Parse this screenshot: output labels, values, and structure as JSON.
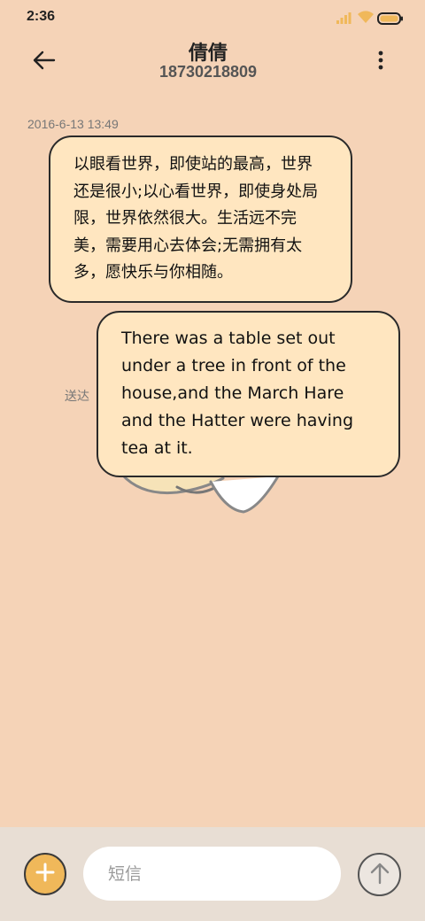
{
  "status_bar": {
    "time": "2:36",
    "signal_icon": "signal-bars-icon",
    "wifi_icon": "wifi-icon",
    "battery_icon": "battery-icon",
    "accent_color": "#f0b85a"
  },
  "header": {
    "contact_name": "倩倩",
    "contact_number": "18730218809",
    "back_icon": "arrow-left-icon",
    "more_icon": "more-vertical-icon"
  },
  "conversation": {
    "timestamp": "2016-6-13 13:49",
    "messages": [
      {
        "direction": "incoming",
        "text": "以眼看世界，即使站的最高，世界还是很小;以心看世界，即使身处局限，世界依然很大。生活远不完美，需要用心去体会;无需拥有太多，愿快乐与你相随。"
      },
      {
        "direction": "outgoing",
        "text": "There was a table set out under a tree in front of the house,and the March Hare and the Hatter were having tea at it.",
        "status": "送达"
      }
    ]
  },
  "input_bar": {
    "placeholder": "短信",
    "value": "",
    "add_icon": "plus-icon",
    "send_icon": "arrow-up-icon"
  },
  "colors": {
    "background": "#f5d3b7",
    "bubble": "#ffe6c0",
    "bubble_border": "#2a2a2a",
    "input_bar": "#e8ded4"
  }
}
